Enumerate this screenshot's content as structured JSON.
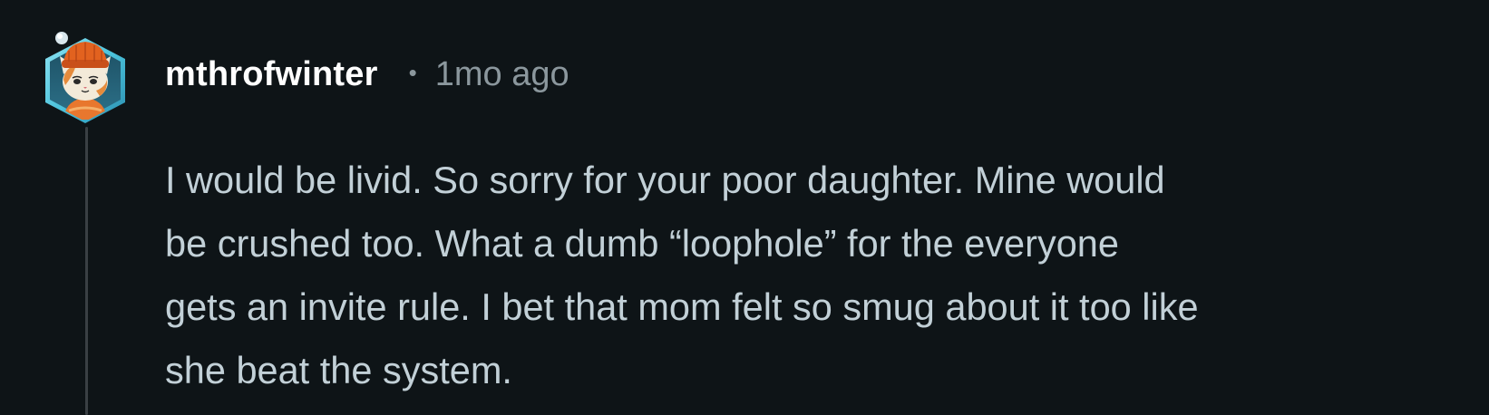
{
  "comment": {
    "author": "mthrofwinter",
    "separator": "•",
    "timestamp": "1mo ago",
    "avatar_icon": "snoovatar-cat-orange-beanie-icon",
    "body_lines": [
      "I would be livid. So sorry for your poor daughter. Mine would",
      "be crushed too. What a dumb “loophole” for the everyone",
      "gets an invite rule. I bet that mom felt so smug about it too like",
      "she beat the system."
    ]
  },
  "colors": {
    "background": "#0e1417",
    "username": "#ffffff",
    "meta": "#8b979d",
    "body": "#c2d0d7",
    "thread_line": "#3a4044",
    "avatar_ring": "#5fd0e6"
  }
}
